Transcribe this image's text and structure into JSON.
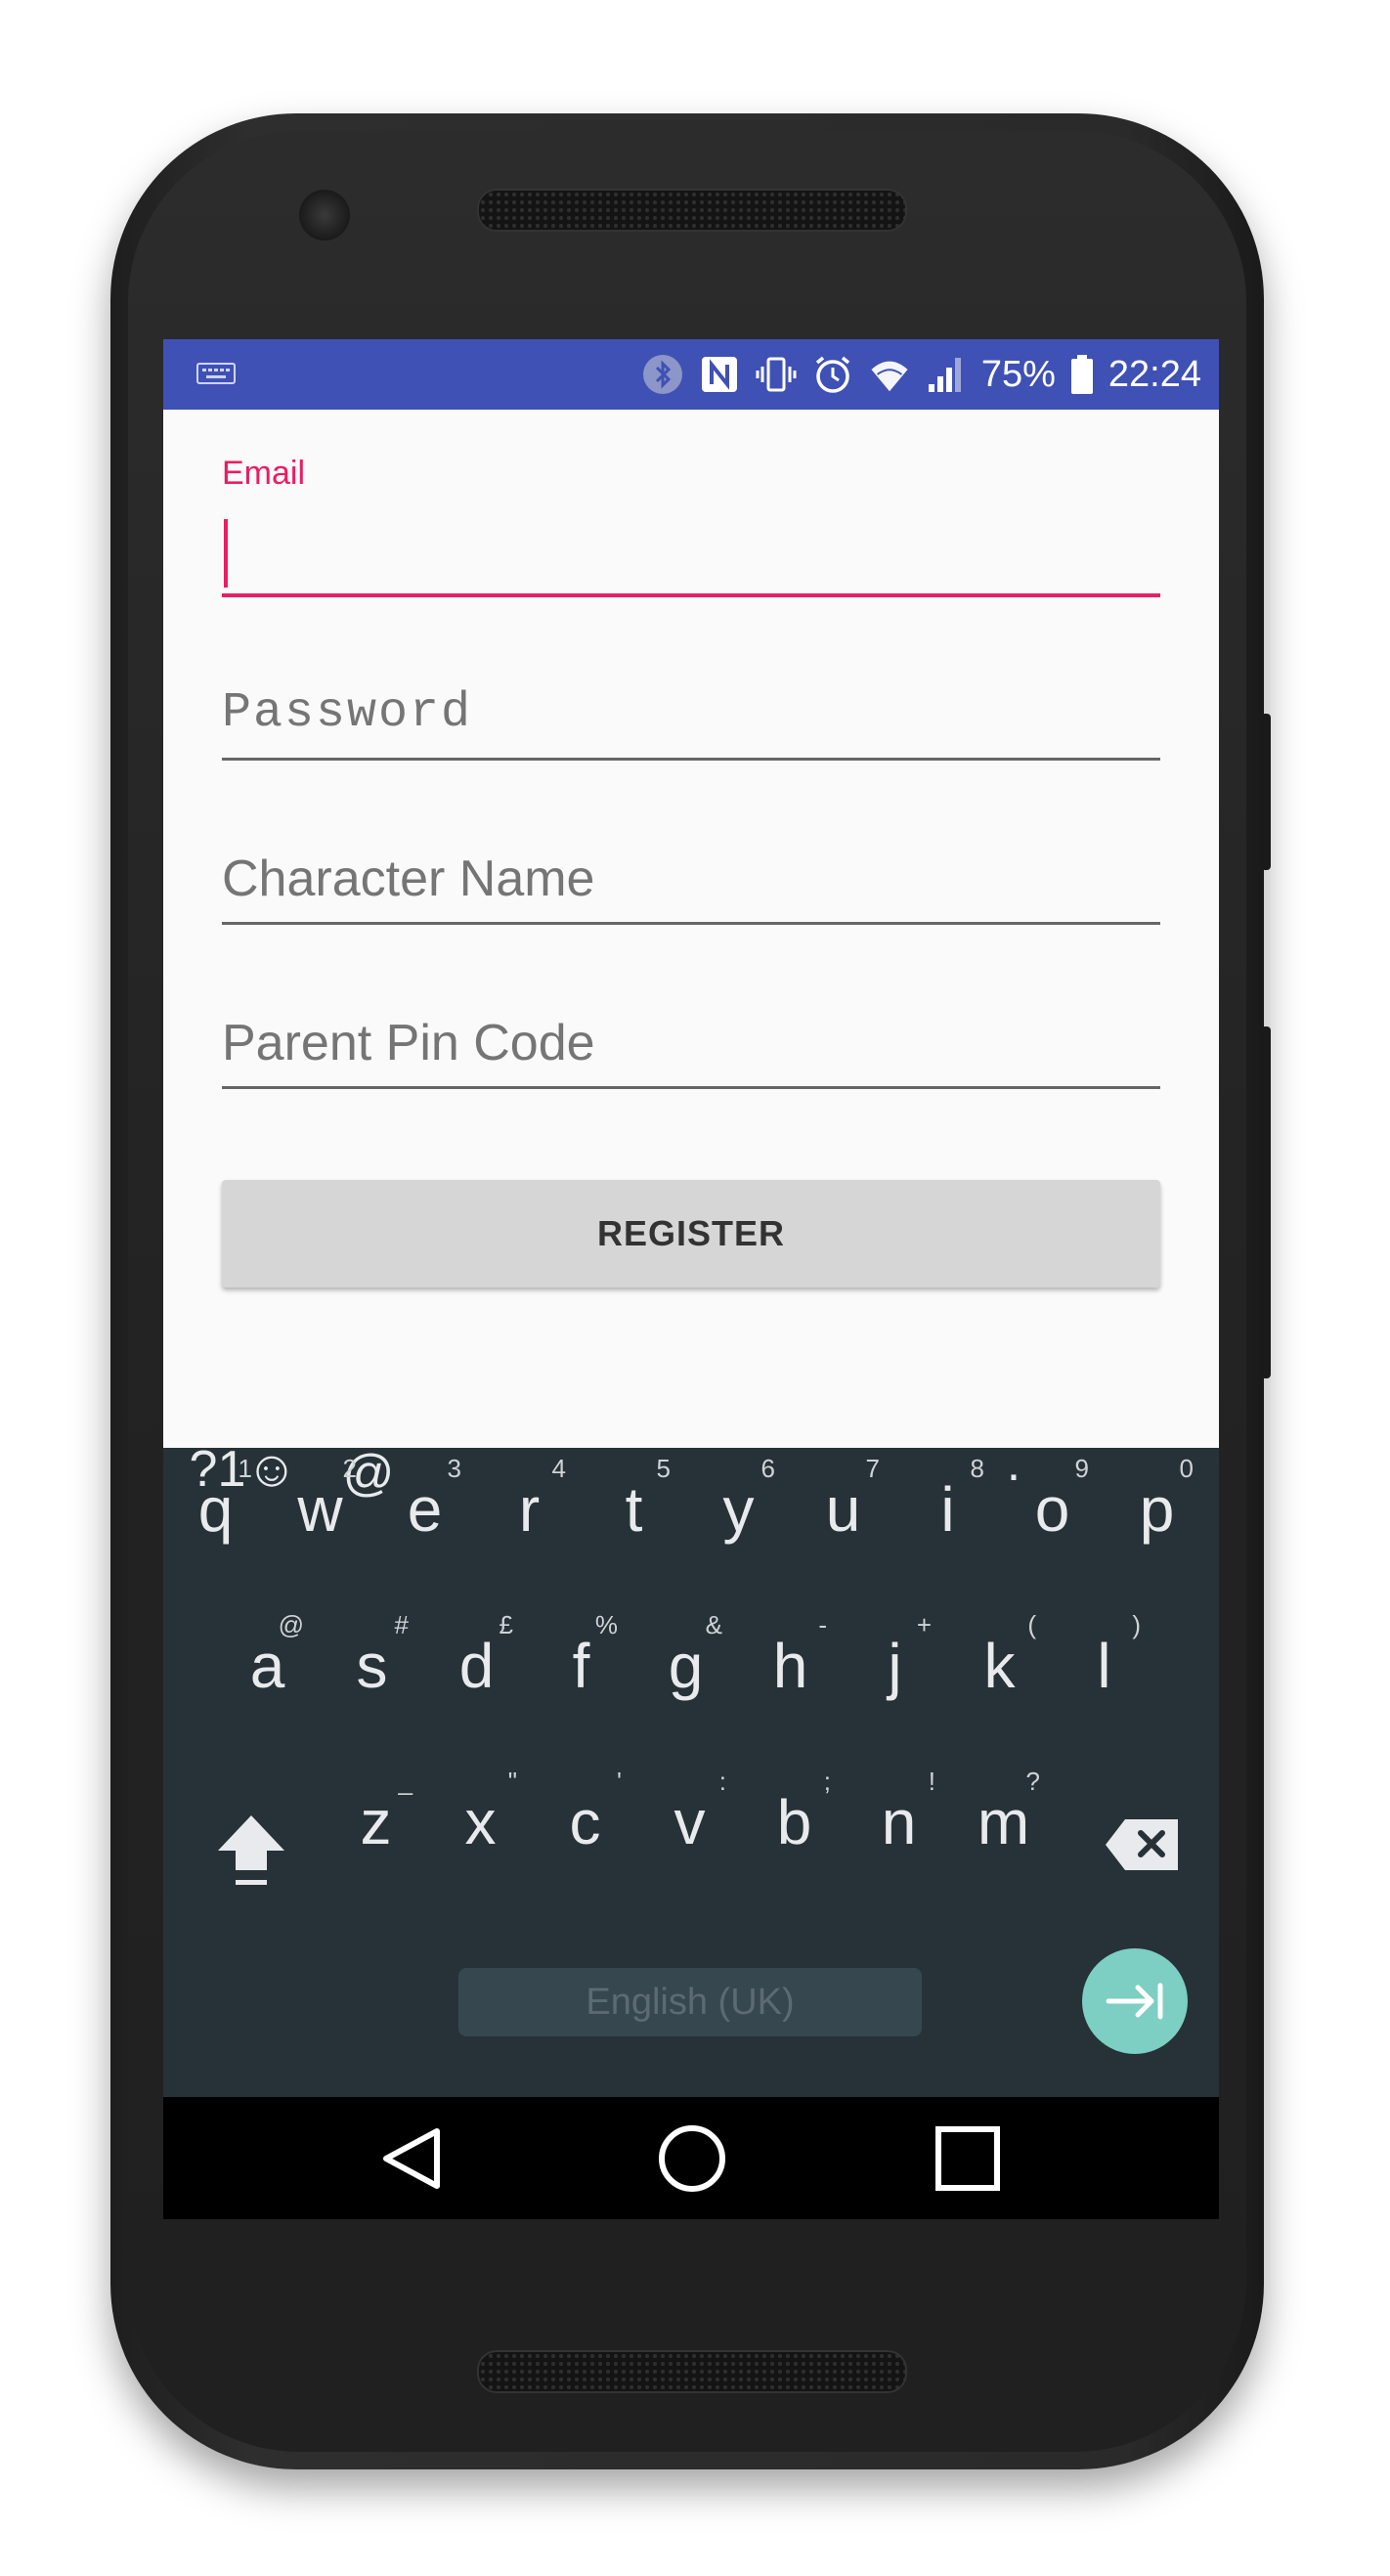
{
  "status_bar": {
    "battery": "75%",
    "time": "22:24",
    "icons": [
      "keyboard-icon",
      "bluetooth-icon",
      "nfc-icon",
      "vibrate-icon",
      "alarm-icon",
      "wifi-icon",
      "signal-icon",
      "battery-icon"
    ],
    "color": "#3f51b5"
  },
  "form": {
    "email": {
      "label": "Email",
      "value": ""
    },
    "password": {
      "placeholder": "Password"
    },
    "character_name": {
      "placeholder": "Character Name"
    },
    "parent_pin": {
      "placeholder": "Parent Pin Code"
    },
    "register_label": "REGISTER",
    "accent_color": "#e91e63"
  },
  "keyboard": {
    "row1": [
      {
        "ch": "q",
        "sup": "1"
      },
      {
        "ch": "w",
        "sup": "2"
      },
      {
        "ch": "e",
        "sup": "3"
      },
      {
        "ch": "r",
        "sup": "4"
      },
      {
        "ch": "t",
        "sup": "5"
      },
      {
        "ch": "y",
        "sup": "6"
      },
      {
        "ch": "u",
        "sup": "7"
      },
      {
        "ch": "i",
        "sup": "8"
      },
      {
        "ch": "o",
        "sup": "9"
      },
      {
        "ch": "p",
        "sup": "0"
      }
    ],
    "row2": [
      {
        "ch": "a",
        "sup": "@"
      },
      {
        "ch": "s",
        "sup": "#"
      },
      {
        "ch": "d",
        "sup": "£"
      },
      {
        "ch": "f",
        "sup": "%"
      },
      {
        "ch": "g",
        "sup": "&"
      },
      {
        "ch": "h",
        "sup": "-"
      },
      {
        "ch": "j",
        "sup": "+"
      },
      {
        "ch": "k",
        "sup": "("
      },
      {
        "ch": "l",
        "sup": ")"
      }
    ],
    "row3": [
      {
        "ch": "z",
        "sup": "_"
      },
      {
        "ch": "x",
        "sup": "\""
      },
      {
        "ch": "c",
        "sup": "'"
      },
      {
        "ch": "v",
        "sup": ":"
      },
      {
        "ch": "b",
        "sup": ";"
      },
      {
        "ch": "n",
        "sup": "!"
      },
      {
        "ch": "m",
        "sup": "?"
      }
    ],
    "symbols_label": "?1☺",
    "at_label": "@",
    "space_label": "English (UK)",
    "period_label": ".",
    "enter_color": "#7dcec3",
    "background": "#263238"
  }
}
